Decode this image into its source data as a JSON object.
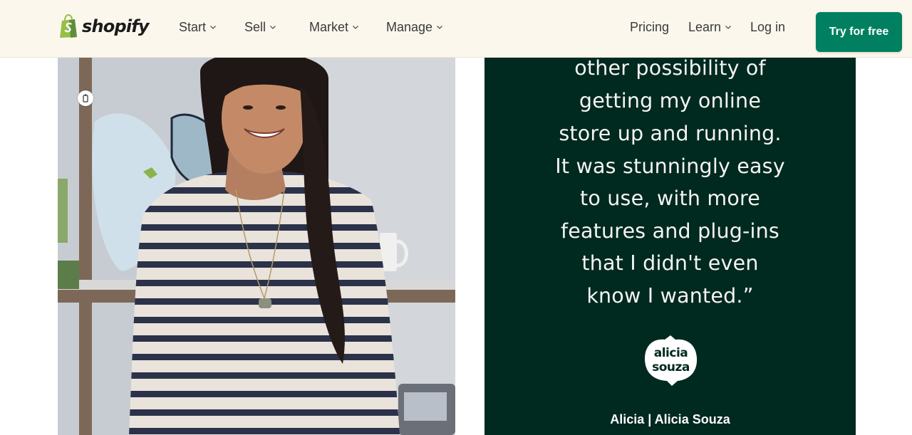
{
  "header": {
    "logo_text": "shopify",
    "nav": [
      {
        "label": "Start",
        "has_menu": true
      },
      {
        "label": "Sell",
        "has_menu": true
      },
      {
        "label": "Market",
        "has_menu": true
      },
      {
        "label": "Manage",
        "has_menu": true
      }
    ],
    "right_nav": [
      {
        "label": "Pricing",
        "has_menu": false
      },
      {
        "label": "Learn",
        "has_menu": true
      },
      {
        "label": "Log in",
        "has_menu": false
      }
    ],
    "cta_label": "Try for free"
  },
  "testimonial": {
    "quote_lines": [
      "other possibility of",
      "getting my online",
      "store up and running.",
      "It was stunningly easy",
      "to use, with more",
      "features and plug-ins",
      "that I didn't even",
      "know I wanted.”"
    ],
    "brand_logo_lines": [
      "alicia",
      "souza"
    ],
    "attribution": "Alicia | Alicia Souza"
  },
  "colors": {
    "header_bg": "#fbf7ed",
    "cta_green": "#008060",
    "quote_panel_bg": "#00291f"
  },
  "icons": {
    "logo": "shopping-bag-icon",
    "nav_menu": "chevron-down-icon",
    "photo_badge": "info-icon"
  }
}
